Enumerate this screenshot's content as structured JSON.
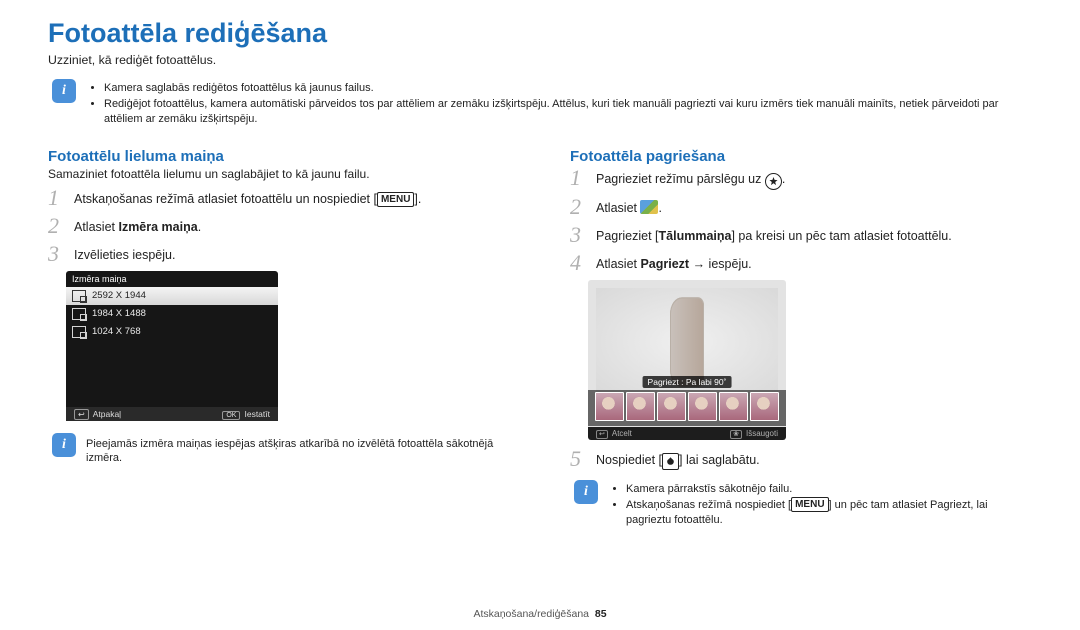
{
  "title": "Fotoattēla rediģēšana",
  "intro": "Uzziniet, kā rediģēt fotoattēlus.",
  "top_notes": [
    "Kamera saglabās rediģētos fotoattēlus kā jaunus failus.",
    "Rediģējot fotoattēlus, kamera automātiski pārveidos tos par attēliem ar zemāku izšķirtspēju. Attēlus, kuri tiek manuāli pagriezti vai kuru izmērs tiek manuāli mainīts, netiek pārveidoti par attēliem ar zemāku izšķirtspēju."
  ],
  "left": {
    "heading": "Fotoattēlu lieluma maiņa",
    "sub": "Samaziniet fotoattēla lielumu un saglabājiet to kā jaunu failu.",
    "step1_pre": "Atskaņošanas režīmā atlasiet fotoattēlu un nospiediet [",
    "step1_post": "].",
    "menu_key": "MENU",
    "step2_pre": "Atlasiet ",
    "step2_bold": "Izmēra maiņa",
    "step2_post": ".",
    "step3": "Izvēlieties iespēju.",
    "lcd_title": "Izmēra maiņa",
    "lcd_options": [
      "2592 X 1944",
      "1984 X 1488",
      "1024 X 768"
    ],
    "lcd_back": "Atpakaļ",
    "lcd_ok": "OK",
    "lcd_set": "Iestatīt",
    "note": "Pieejamās izmēra maiņas iespējas atšķiras atkarībā no izvēlētā fotoattēla sākotnējā izmēra."
  },
  "right": {
    "heading": "Fotoattēla pagriešana",
    "step1_pre": "Pagrieziet režīmu pārslēgu uz ",
    "step1_post": ".",
    "step2_pre": "Atlasiet ",
    "step2_post": ".",
    "step3_pre": "Pagrieziet [",
    "step3_bold": "Tālummaiņa",
    "step3_post": "] pa kreisi un pēc tam atlasiet fotoattēlu.",
    "step4_pre": "Atlasiet ",
    "step4_bold": "Pagriezt",
    "step4_mid": " → iespēju.",
    "rot_label": "Pagriezt : Pa labi 90˚",
    "rot_cancel": "Atcelt",
    "rot_save": "Išsaugoti",
    "step5_pre": "Nospiediet [",
    "step5_post": "] lai saglabātu.",
    "note_bullets_1": "Kamera pārrakstīs sākotnējo failu.",
    "note_bullets_2a": "Atskaņošanas režīmā nospiediet [",
    "note_bullets_2_menu": "MENU",
    "note_bullets_2b": "] un pēc tam atlasiet ",
    "note_bullets_2_bold": "Pagriezt",
    "note_bullets_2c": ", lai pagrieztu fotoattēlu."
  },
  "footer_section": "Atskaņošana/rediģēšana",
  "footer_page": "85"
}
